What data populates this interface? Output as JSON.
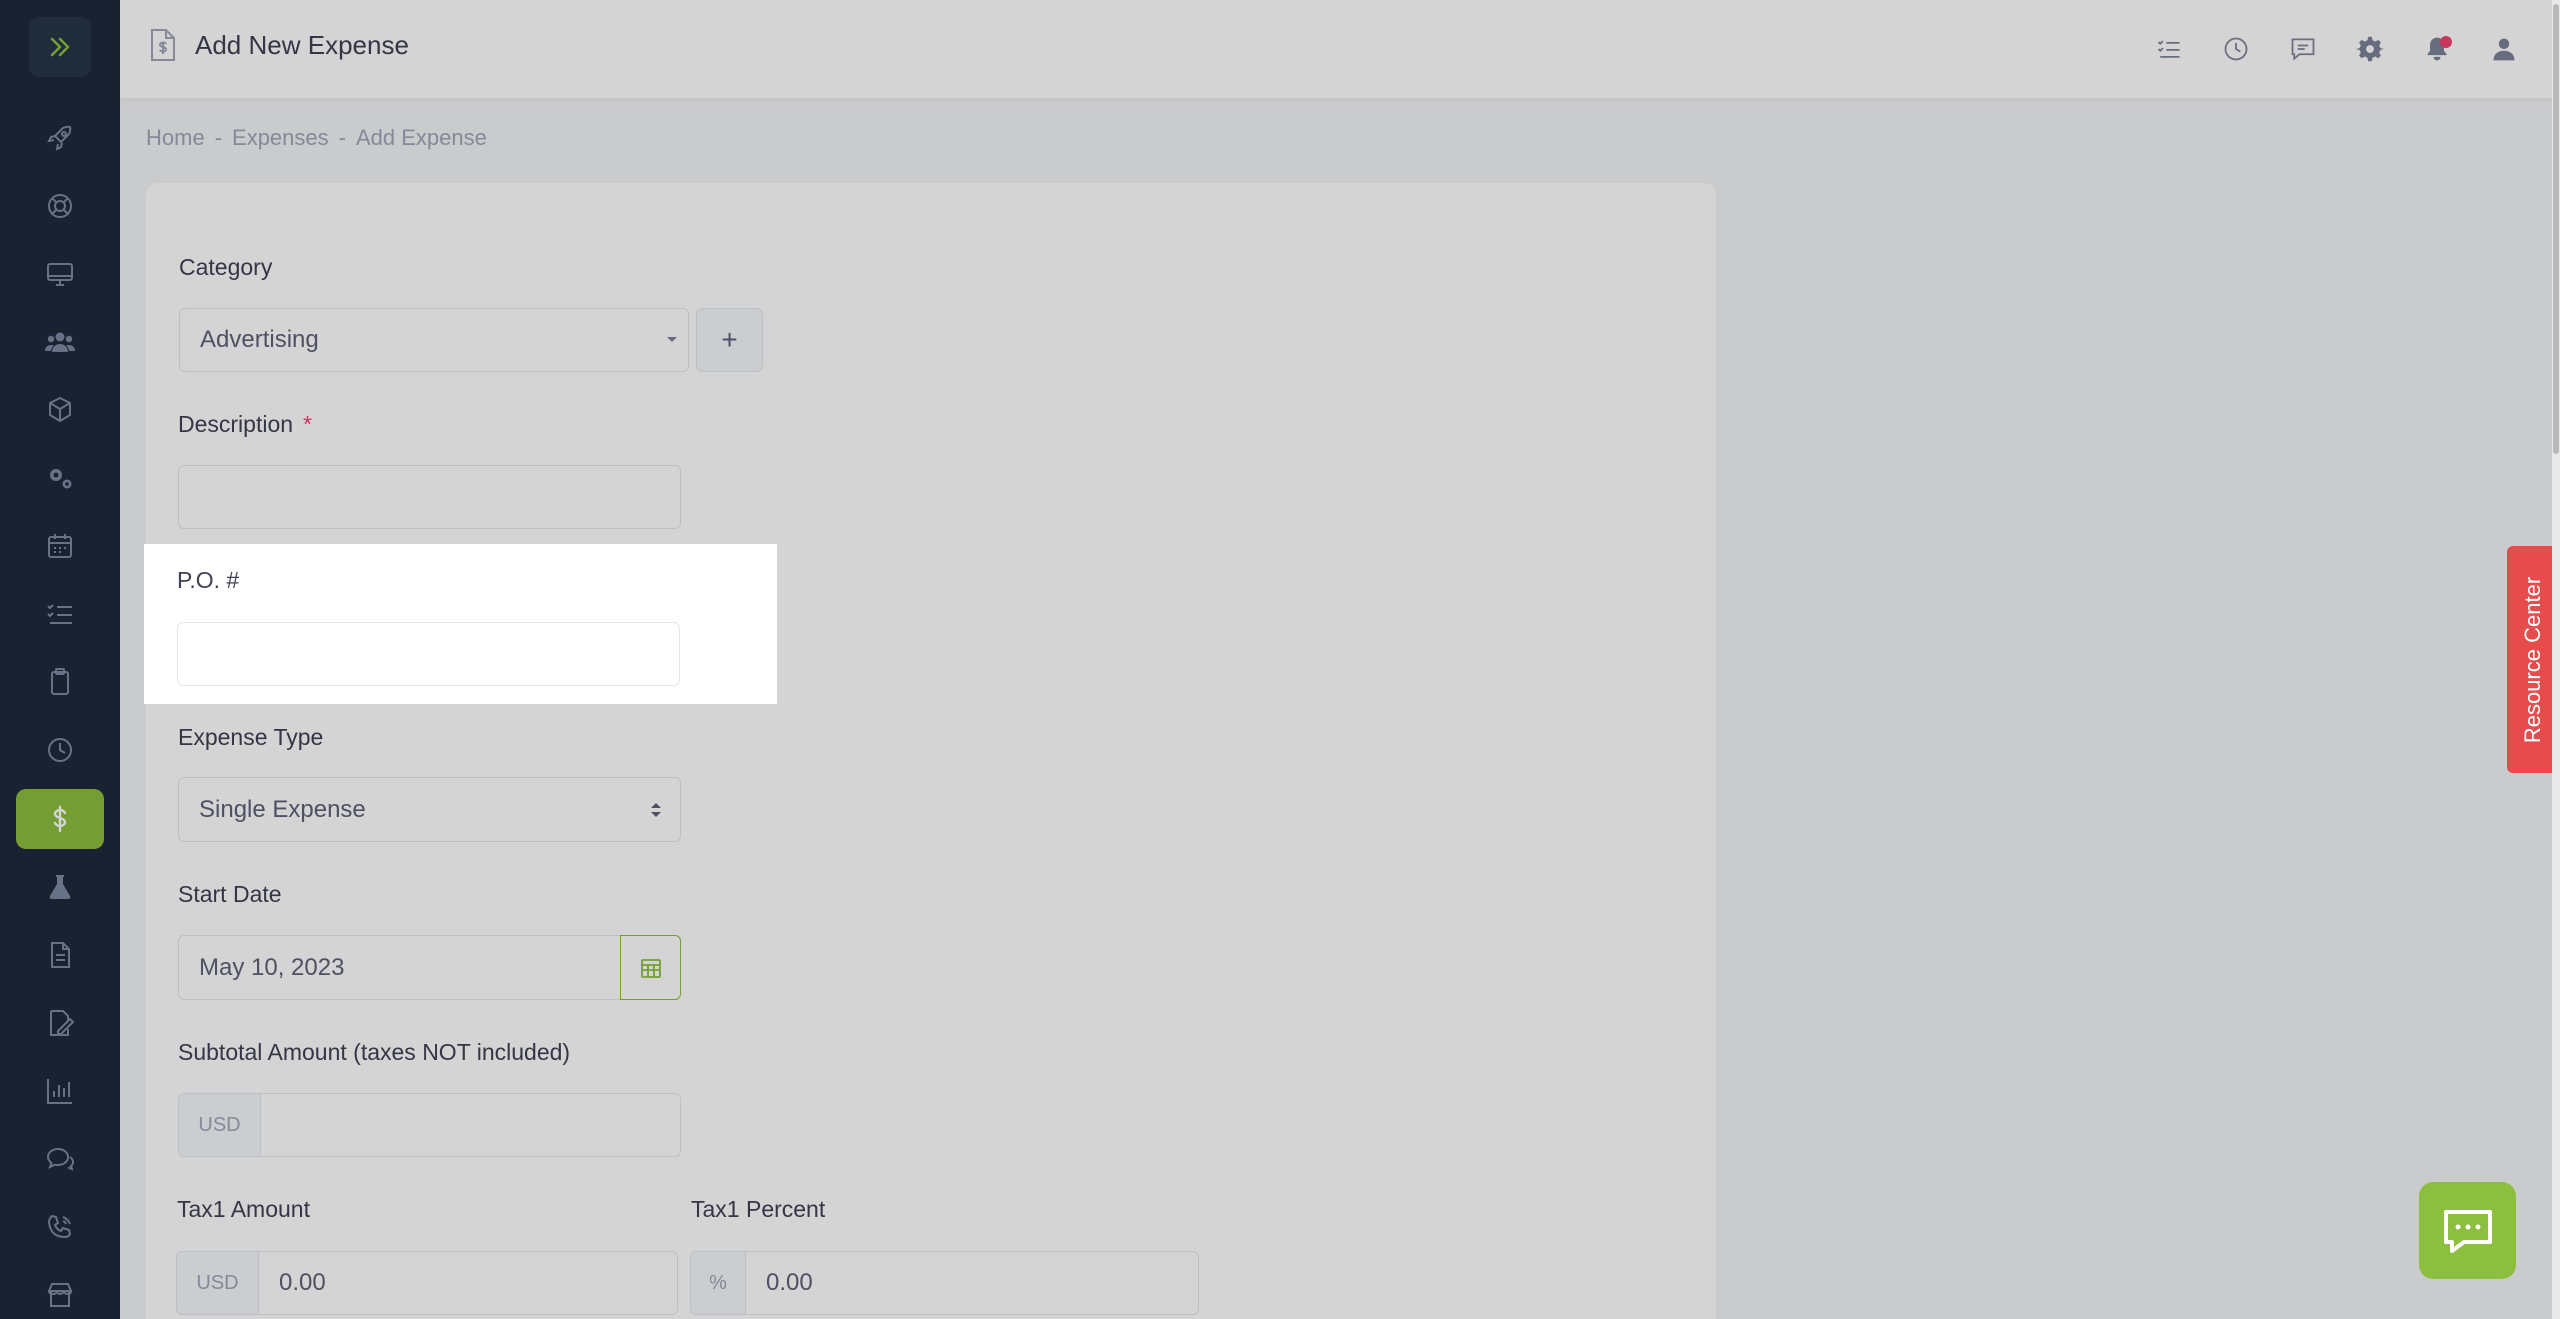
{
  "header": {
    "title": "Add New Expense"
  },
  "breadcrumb": {
    "items": [
      "Home",
      "Expenses",
      "Add Expense"
    ],
    "separator": "-"
  },
  "form": {
    "category": {
      "label": "Category",
      "value": "Advertising",
      "add_button": "+"
    },
    "description": {
      "label": "Description",
      "required_mark": "*",
      "value": ""
    },
    "po_number": {
      "label": "P.O. #",
      "value": ""
    },
    "expense_type": {
      "label": "Expense Type",
      "value": "Single Expense"
    },
    "start_date": {
      "label": "Start Date",
      "value": "May 10, 2023"
    },
    "subtotal": {
      "label": "Subtotal Amount (taxes NOT included)",
      "currency": "USD",
      "value": ""
    },
    "tax1_amount": {
      "label": "Tax1 Amount",
      "currency": "USD",
      "value": "0.00"
    },
    "tax1_percent": {
      "label": "Tax1 Percent",
      "unit": "%",
      "value": "0.00"
    }
  },
  "resource_center": {
    "label": "Resource Center"
  },
  "colors": {
    "accent": "#8cbf3f",
    "sidebar_bg": "#1e2a3a",
    "resource_center": "#e74c4c",
    "required": "#f1416c"
  },
  "sidebar": {
    "items": [
      {
        "icon": "rocket-icon"
      },
      {
        "icon": "lifebuoy-icon"
      },
      {
        "icon": "monitor-icon"
      },
      {
        "icon": "users-icon"
      },
      {
        "icon": "cube-icon"
      },
      {
        "icon": "gears-icon"
      },
      {
        "icon": "calendar-icon"
      },
      {
        "icon": "checklist-icon"
      },
      {
        "icon": "clipboard-icon"
      },
      {
        "icon": "clock-icon"
      },
      {
        "icon": "dollar-icon",
        "active": true
      },
      {
        "icon": "flask-icon"
      },
      {
        "icon": "document-icon"
      },
      {
        "icon": "signature-icon"
      },
      {
        "icon": "bar-chart-icon"
      },
      {
        "icon": "chat-icon"
      },
      {
        "icon": "phone-icon"
      },
      {
        "icon": "store-icon"
      }
    ]
  }
}
